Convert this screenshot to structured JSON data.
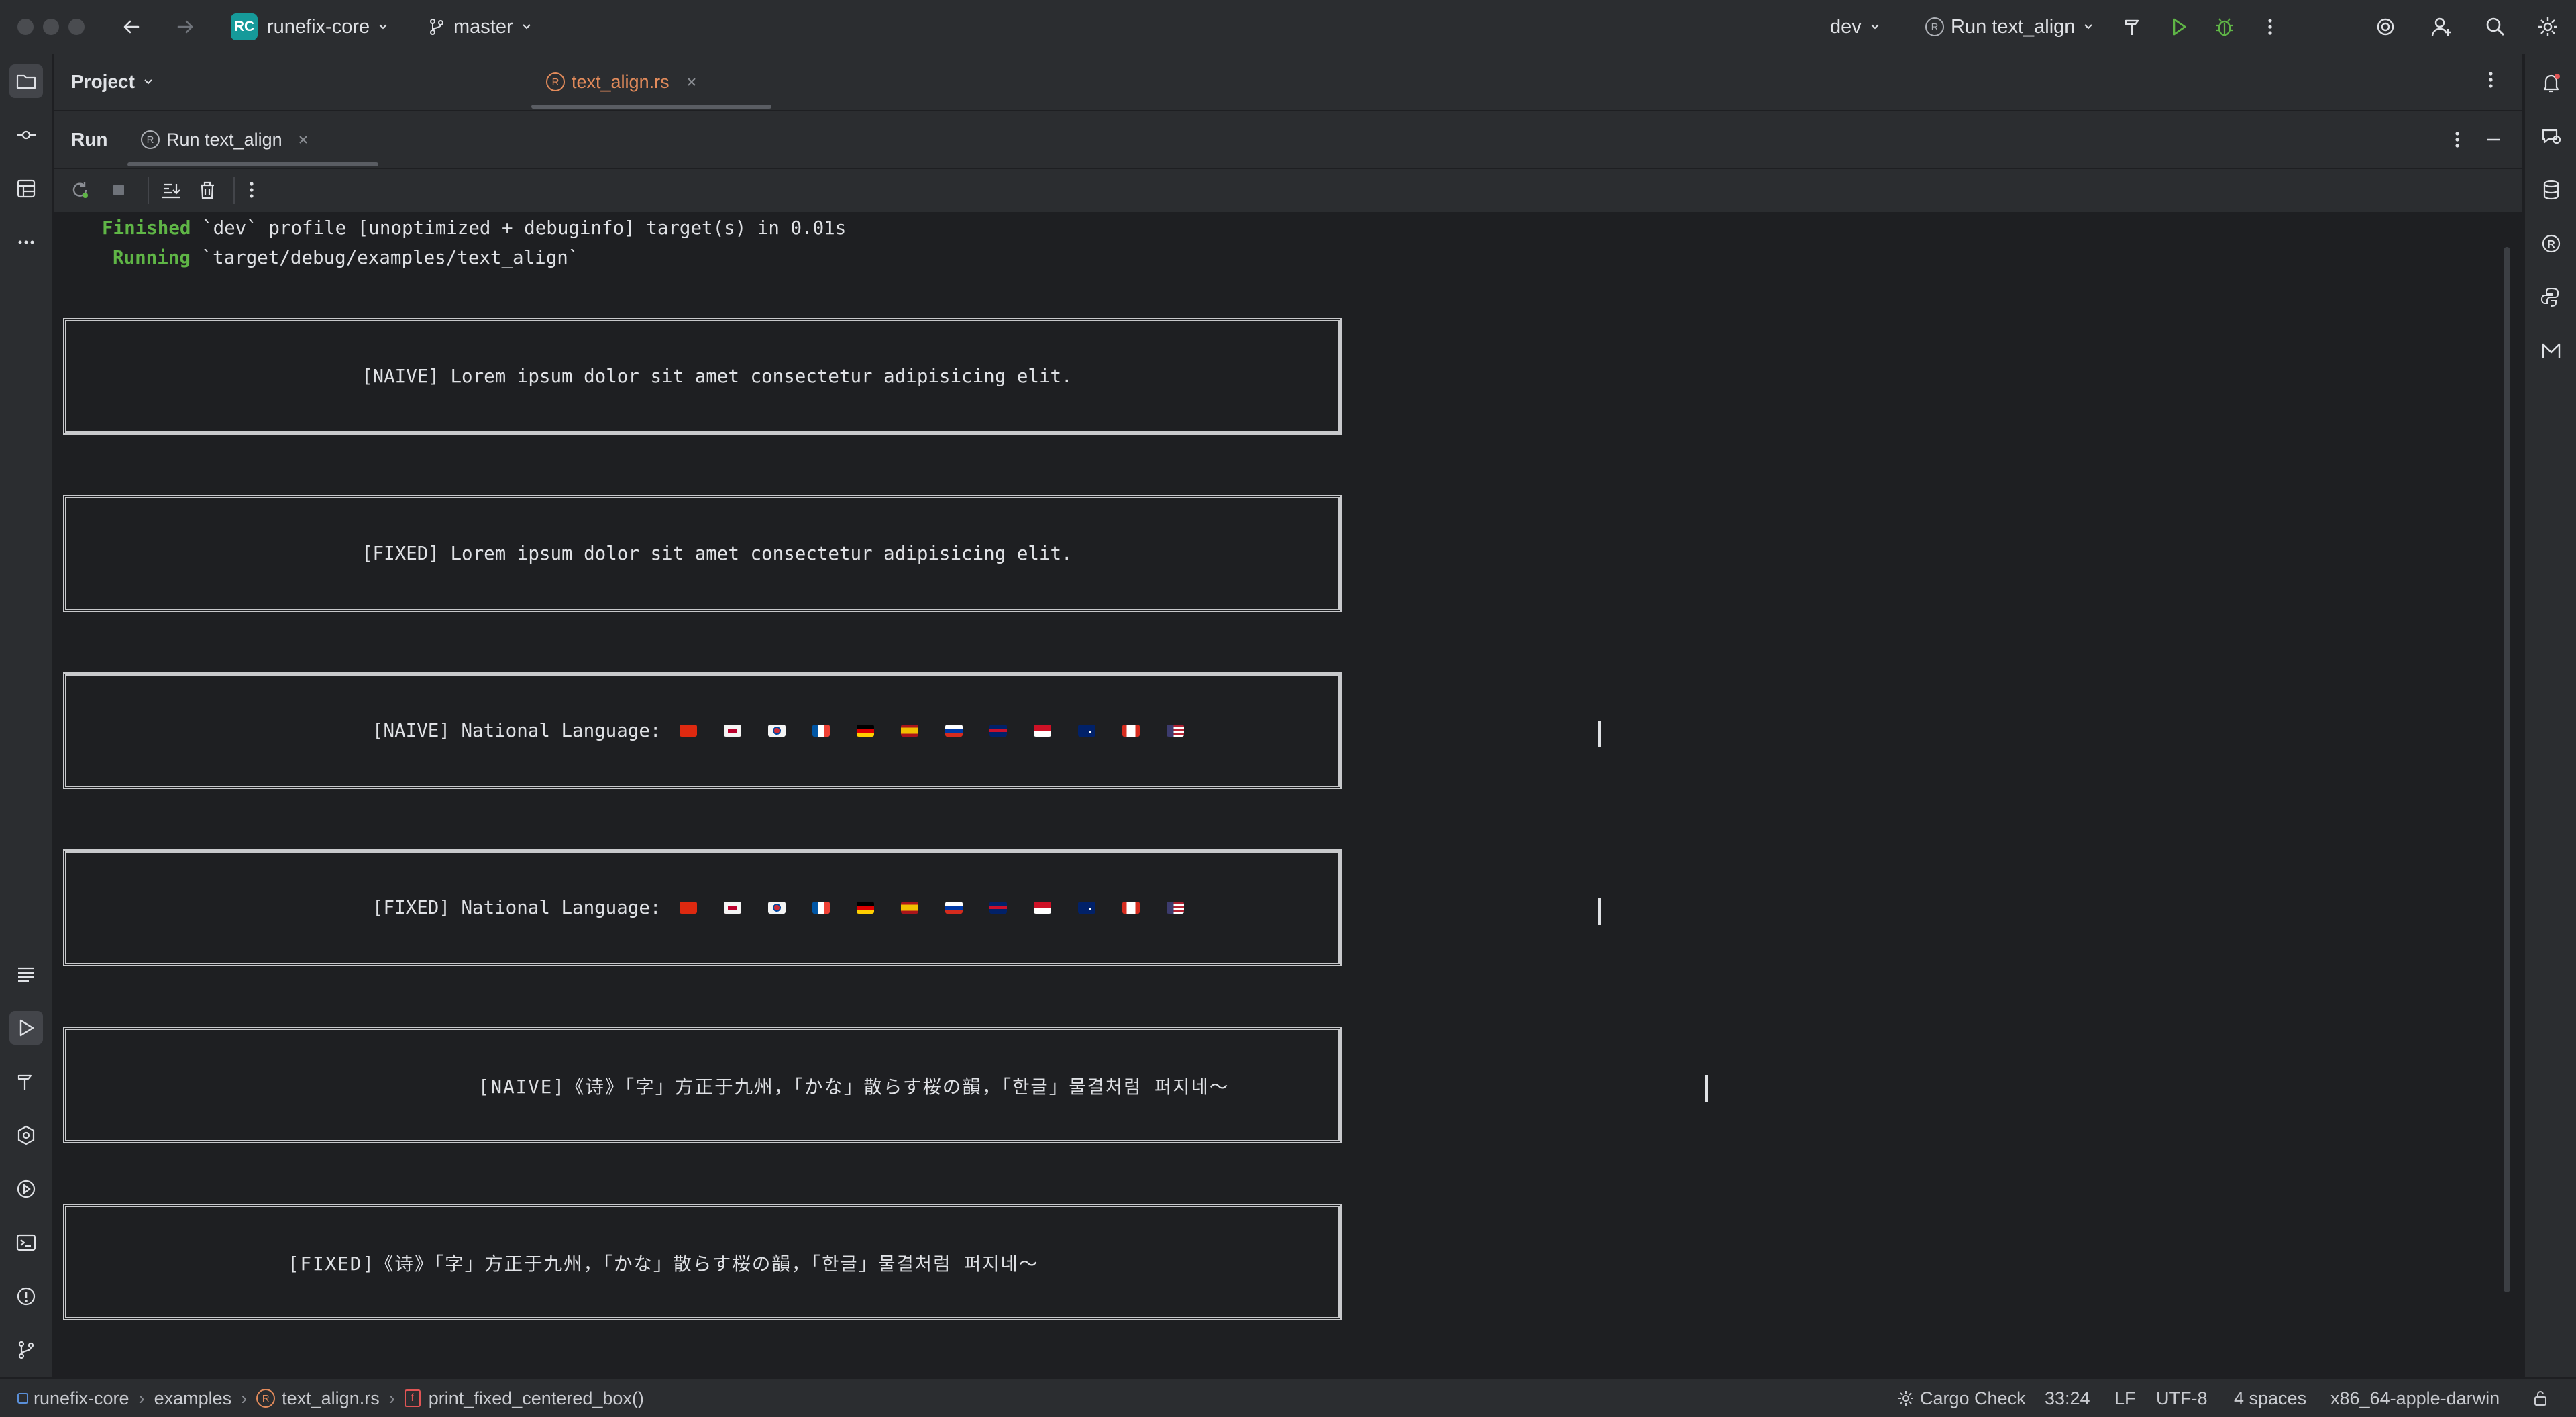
{
  "titlebar": {
    "project_badge": "RC",
    "project_name": "runefix-core",
    "branch": "master",
    "profile": "dev",
    "run_config": "Run text_align"
  },
  "project_panel": {
    "title": "Project"
  },
  "editor": {
    "active_tab": "text_align.rs"
  },
  "run_window": {
    "label": "Run",
    "tab": "Run text_align"
  },
  "console": {
    "line1_status": "Finished",
    "line1_rest": " `dev` profile [unoptimized + debuginfo] target(s) in 0.01s",
    "line2_status": "Running",
    "line2_rest": " `target/debug/examples/text_align`",
    "box1_text": "[NAIVE] Lorem ipsum dolor sit amet consectetur adipisicing elit.",
    "box2_text": "[FIXED] Lorem ipsum dolor sit amet consectetur adipisicing elit.",
    "box3_text": "[NAIVE] National Language:",
    "box4_text": "[FIXED] National Language:",
    "box5_text": "[NAIVE]《诗》「字」方正于九州，「かな」散らす桜の韻，「한글」물결처럼 퍼지네～",
    "box6_text": "[FIXED]《诗》「字」方正于九州，「かな」散らす桜の韻，「한글」물결처럼 퍼지네～",
    "flags": [
      "cn-flag-icon",
      "jp-flag-icon",
      "kr-flag-icon",
      "fr-flag-icon",
      "de-flag-icon",
      "es-flag-icon",
      "ru-flag-icon",
      "gb-flag-icon",
      "id-flag-icon",
      "au-flag-icon",
      "ca-flag-icon",
      "us-flag-icon"
    ]
  },
  "statusbar": {
    "crumb_project": "runefix-core",
    "crumb_folder": "examples",
    "crumb_file": "text_align.rs",
    "crumb_fn": "print_fixed_centered_box()",
    "cargo_check": "Cargo Check",
    "position": "33:24",
    "line_sep": "LF",
    "encoding": "UTF-8",
    "indent": "4 spaces",
    "target": "x86_64-apple-darwin"
  },
  "colors": {
    "accent_green": "#5fb546",
    "rust_orange": "#e38b5b",
    "background": "#1e1f22",
    "panel": "#2b2d30"
  }
}
